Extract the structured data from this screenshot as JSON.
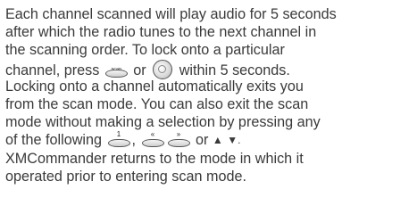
{
  "paragraph": {
    "line1": "Each channel scanned will play audio for 5 seconds",
    "line2": "after which the radio tunes to the next channel in",
    "line3": "the scanning order. To lock onto a particular",
    "line4_pre": "channel, press",
    "line4_mid": "or",
    "line4_post": "within 5 seconds.",
    "line5": "Locking onto a channel automatically exits you",
    "line6": "from the scan mode. You can also exit the scan",
    "line7": "mode without making a selection by pressing any",
    "line8_pre": "of the following",
    "line8_comma": ",",
    "line8_or": "or",
    "line8_up": "▲",
    "line8_down": "▼.",
    "line9": "XMCommander returns to the mode in which it",
    "line10": "operated prior to entering scan mode."
  },
  "icons": {
    "scan_label": "scan",
    "preset_label": "1",
    "prev_label": "«",
    "next_label": "»"
  }
}
